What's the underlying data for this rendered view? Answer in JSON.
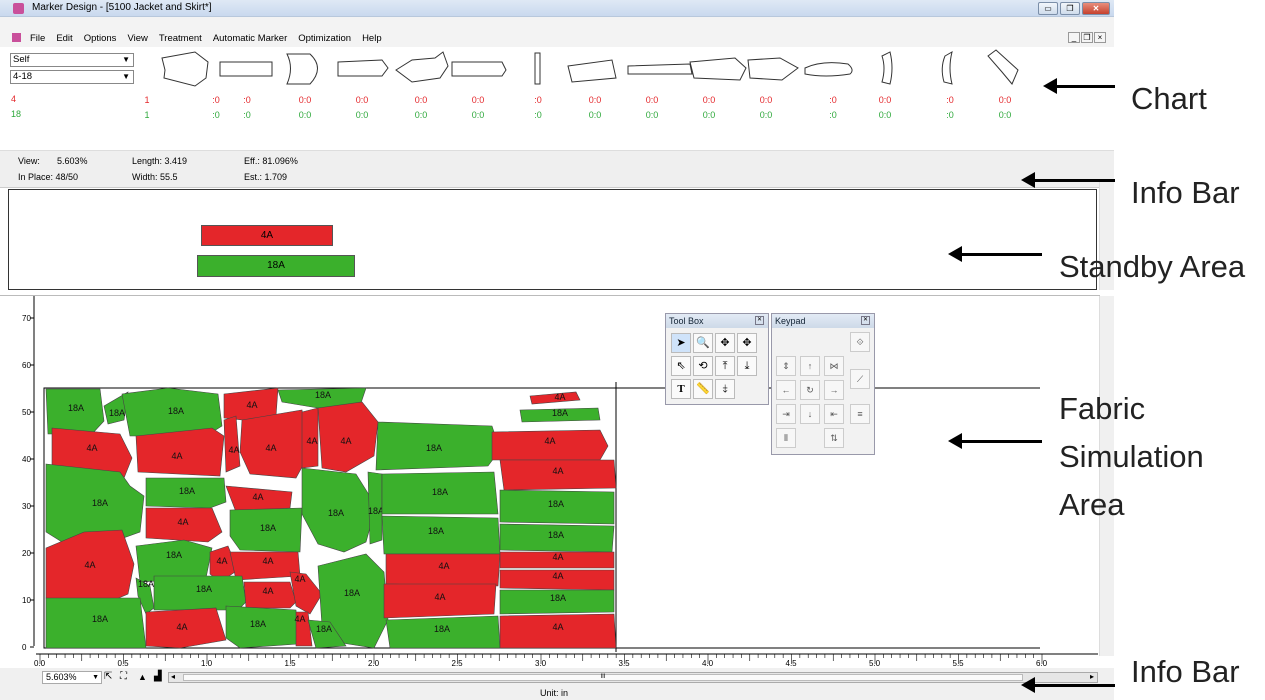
{
  "window": {
    "title": "Marker Design - [5100 Jacket and Skirt*]"
  },
  "menu": [
    "File",
    "Edit",
    "Options",
    "View",
    "Treatment",
    "Automatic Marker",
    "Optimization",
    "Help"
  ],
  "selectors": {
    "view_mode": "Self",
    "size_range": "4-18"
  },
  "chart": {
    "sizes": [
      {
        "label": "4",
        "color": "#e4262a"
      },
      {
        "label": "18",
        "color": "#2ea83b"
      }
    ],
    "row_4": [
      "1",
      ":0",
      ":0",
      "0:0",
      "0:0",
      "0:0",
      "0:0",
      ":0",
      "0:0",
      "0:0",
      "0:0",
      "0:0",
      ":0",
      "0:0",
      ":0",
      "0:0"
    ],
    "row_18": [
      "1",
      ":0",
      ":0",
      "0:0",
      "0:0",
      "0:0",
      "0:0",
      ":0",
      "0:0",
      "0:0",
      "0:0",
      "0:0",
      ":0",
      "0:0",
      ":0",
      "0:0"
    ]
  },
  "info": {
    "view": "View:",
    "view_val": "5.603%",
    "inplace": "In Place: 48/50",
    "length": "Length: 3.419",
    "width": "Width:  55.5",
    "eff": "Eff.: 81.096%",
    "est": "Est.: 1.709"
  },
  "standby": {
    "piece_red": "4A",
    "piece_green": "18A"
  },
  "toolbox": {
    "title": "Tool Box"
  },
  "keypad": {
    "title": "Keypad"
  },
  "yaxis": [
    "70",
    "60",
    "50",
    "40",
    "30",
    "20",
    "10",
    "0"
  ],
  "xaxis": [
    "0.0",
    "0.5",
    "1.0",
    "1.5",
    "2.0",
    "2.5",
    "3.0",
    "3.5",
    "4.0",
    "4.5",
    "5.0",
    "5.5",
    "6.0"
  ],
  "bottom": {
    "zoom": "5.603%",
    "unit": "Unit: in"
  },
  "scroll_mid": "III",
  "annotations": [
    "Chart",
    "Info Bar",
    "Standby Area",
    "Fabric",
    "Simulation",
    "Area",
    "Info Bar"
  ],
  "pieces": {
    "red": "4A",
    "green": "18A"
  },
  "colors": {
    "red": "#e4262a",
    "green": "#3bb02c"
  }
}
